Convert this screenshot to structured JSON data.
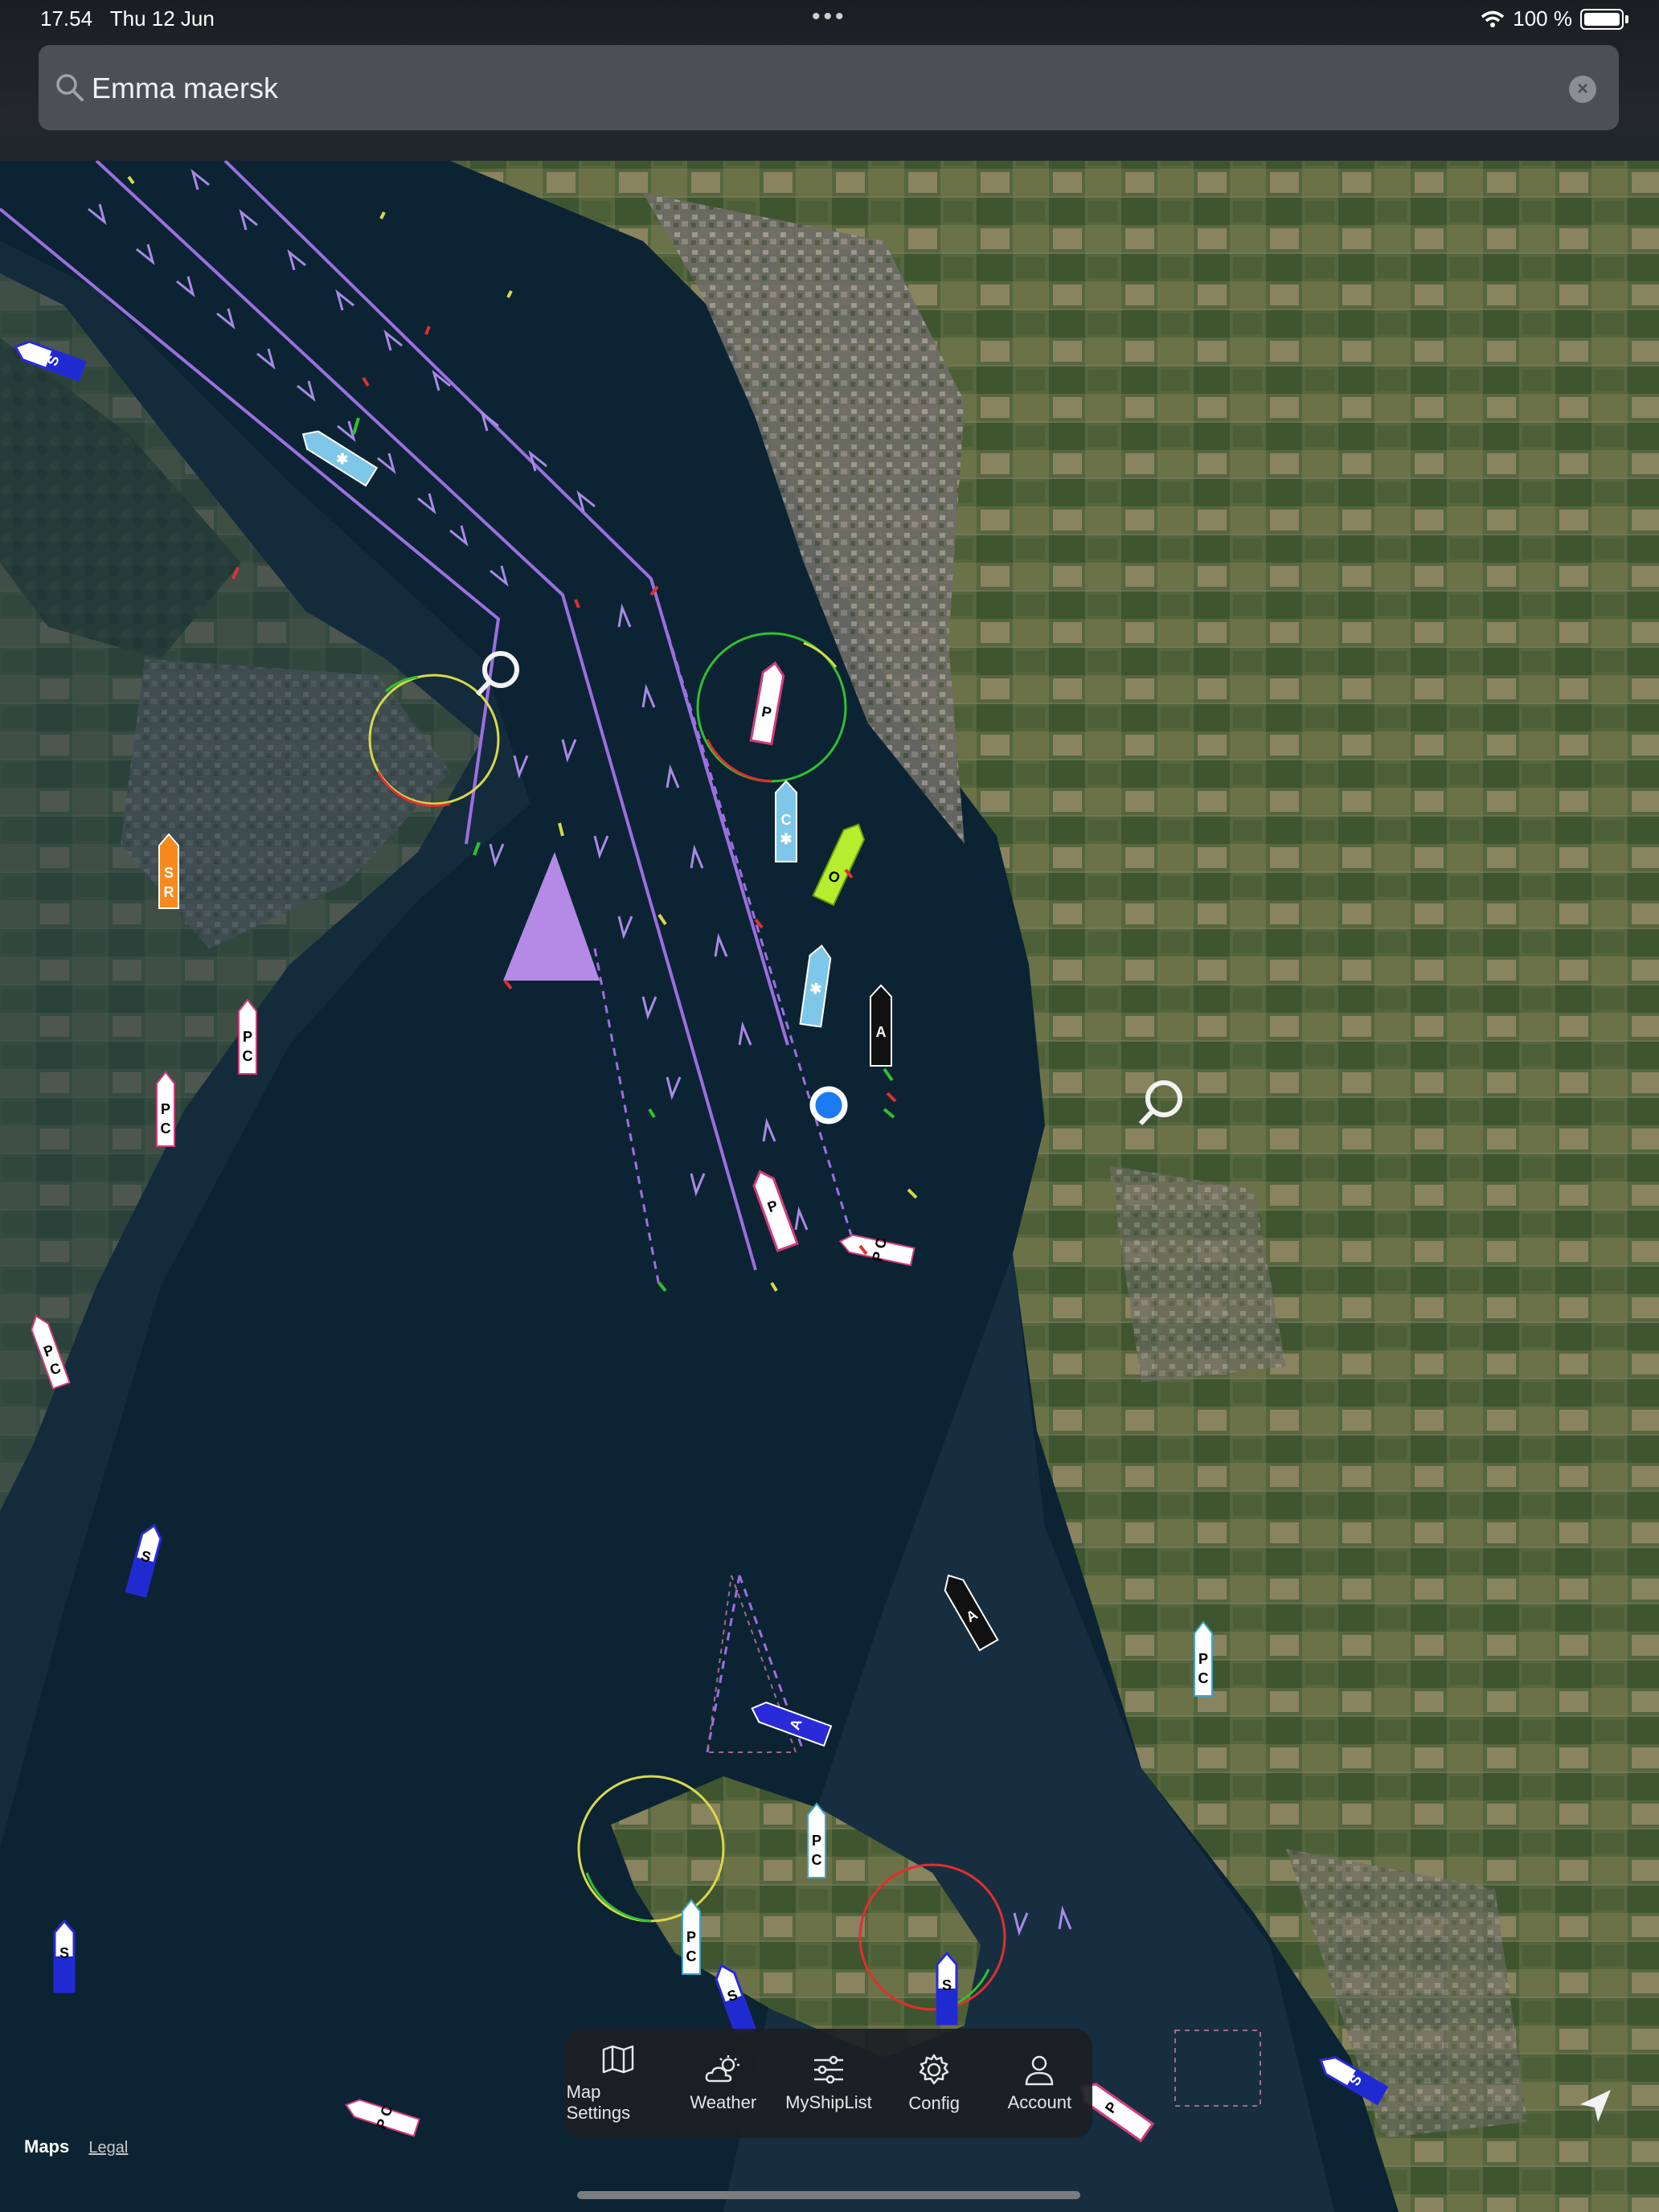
{
  "status_bar": {
    "time": "17.54",
    "date": "Thu 12 Jun",
    "battery": "100 %"
  },
  "search": {
    "value": "Emma maersk",
    "placeholder": ""
  },
  "tabs": [
    {
      "label": "Map Settings",
      "icon": "map-icon"
    },
    {
      "label": "Weather",
      "icon": "cloud-sun-icon"
    },
    {
      "label": "MyShipList",
      "icon": "sliders-icon"
    },
    {
      "label": "Config",
      "icon": "gear-icon"
    },
    {
      "label": "Account",
      "icon": "person-icon"
    }
  ],
  "attribution": {
    "maps": "Maps",
    "legal": "Legal"
  },
  "vessels": [
    {
      "label": "P C"
    },
    {
      "label": "P C"
    },
    {
      "label": "P C"
    },
    {
      "label": "P C"
    },
    {
      "label": "S"
    },
    {
      "label": "S"
    },
    {
      "label": "S"
    },
    {
      "label": "S"
    },
    {
      "label": "P"
    },
    {
      "label": "P"
    },
    {
      "label": "O"
    },
    {
      "label": "A"
    }
  ],
  "colors": {
    "sea": "#0c2333",
    "deep_sea": "#0a1f2e",
    "land": "#5b6a43",
    "traffic_lane": "#9b6fe0",
    "status_bg": "#1b1e21",
    "search_bg": "#4c5054",
    "location_dot": "#1a7cf0"
  }
}
